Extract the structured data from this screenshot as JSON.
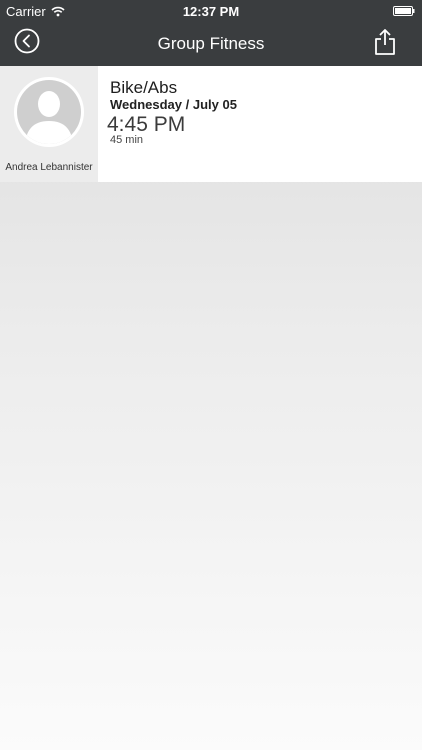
{
  "status_bar": {
    "carrier": "Carrier",
    "time": "12:37 PM",
    "wifi_icon": "wifi-icon",
    "battery_icon": "battery-icon"
  },
  "nav": {
    "title": "Group Fitness",
    "back_icon": "back-circle-icon",
    "share_icon": "share-icon"
  },
  "class_item": {
    "instructor": "Andrea Lebannister",
    "avatar_icon": "person-placeholder-icon",
    "name": "Bike/Abs",
    "date": "Wednesday / July 05",
    "time": "4:45 PM",
    "duration": "45 min"
  },
  "colors": {
    "header_background": "#3a3d3f",
    "header_text": "#ffffff",
    "instructor_panel": "#ececec",
    "details_panel": "#ffffff"
  }
}
